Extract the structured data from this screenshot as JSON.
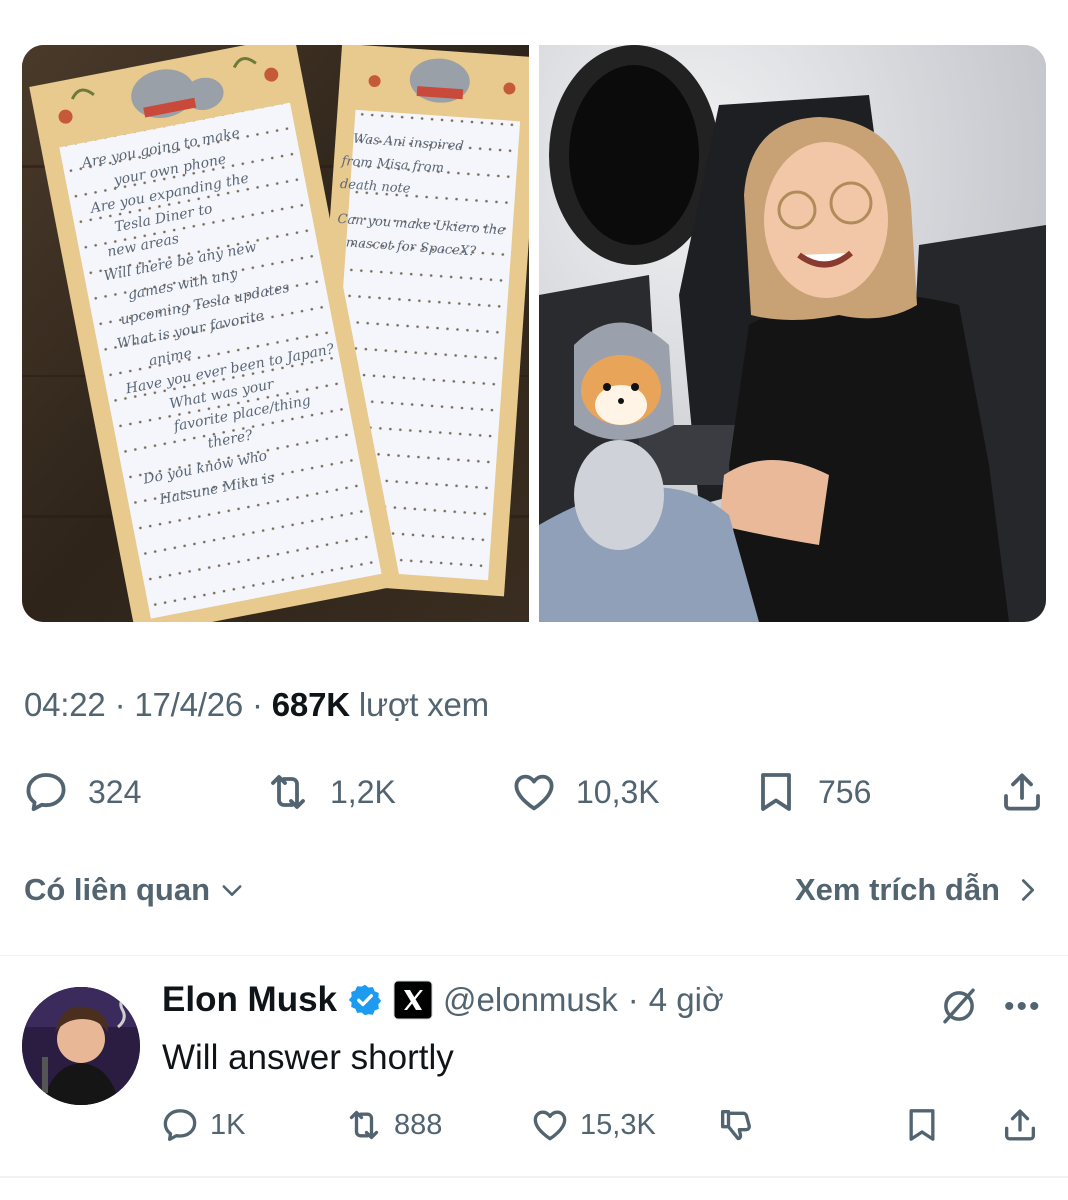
{
  "tweet": {
    "time": "04:22",
    "date": "17/4/26",
    "views_count": "687K",
    "views_label": "lượt xem",
    "metrics": {
      "replies": "324",
      "reposts": "1,2K",
      "likes": "10,3K",
      "bookmarks": "756"
    }
  },
  "letters": {
    "left_lines": [
      "Are you going to make",
      "your own phone",
      "Are you expanding the",
      "Tesla Diner to",
      "new areas",
      "Will there be any new",
      "games with any",
      "upcoming Tesla updates",
      "What is your favorite",
      "anime",
      "Have you ever been to Japan?",
      "What was your",
      "favorite place/thing",
      "there?",
      "Do you know who",
      "Hatsune Miku is"
    ],
    "right_lines": [
      "Was Ani inspired",
      "from Misa from",
      "death note",
      "Can you make Ukiero the",
      "mascot for SpaceX?"
    ]
  },
  "related": {
    "left_label": "Có liên quan",
    "right_label": "Xem trích dẫn"
  },
  "reply": {
    "name": "Elon Musk",
    "handle": "@elonmusk",
    "time": "4 giờ",
    "text": "Will answer shortly",
    "metrics": {
      "replies": "1K",
      "reposts": "888",
      "likes": "15,3K"
    }
  },
  "colors": {
    "text_primary": "#0f1419",
    "text_secondary": "#536471",
    "verified_blue": "#1d9bf0",
    "letter_paper": "#e8c98e",
    "letter_sheet": "#f4f6fb",
    "ink": "#5b6776"
  },
  "icons": {
    "reply": "speech-bubble-icon",
    "repost": "repost-arrows-icon",
    "like": "heart-icon",
    "bookmark": "bookmark-icon",
    "share": "share-upload-icon",
    "verified": "verified-badge-icon",
    "affiliate": "x-logo-badge-icon",
    "grok": "grok-icon",
    "more": "more-dots-icon",
    "dislike": "thumbs-down-icon",
    "chevron_down": "chevron-down-icon",
    "chevron_right": "chevron-right-icon"
  }
}
